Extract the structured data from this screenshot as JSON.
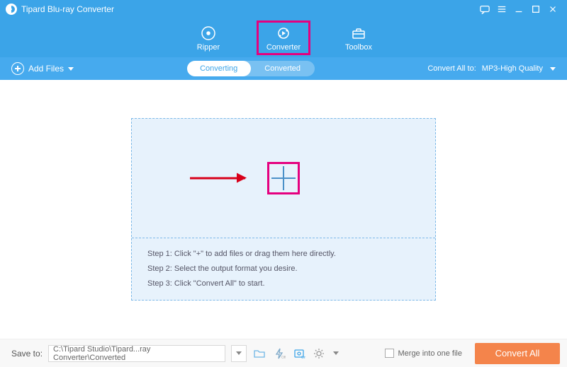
{
  "app": {
    "title": "Tipard Blu-ray Converter"
  },
  "modes": {
    "ripper": {
      "label": "Ripper"
    },
    "converter": {
      "label": "Converter",
      "highlighted": true
    },
    "toolbox": {
      "label": "Toolbox"
    }
  },
  "optbar": {
    "add_files": "Add Files",
    "tab_converting": "Converting",
    "tab_converted": "Converted",
    "convert_all_to": "Convert All to:",
    "convert_all_value": "MP3-High Quality"
  },
  "drop": {
    "step1": "Step 1: Click \"+\" to add files or drag them here directly.",
    "step2": "Step 2: Select the output format you desire.",
    "step3": "Step 3: Click \"Convert All\" to start."
  },
  "bottom": {
    "save_to": "Save to:",
    "path": "C:\\Tipard Studio\\Tipard...ray Converter\\Converted",
    "merge": "Merge into one file",
    "convert_all": "Convert All"
  }
}
